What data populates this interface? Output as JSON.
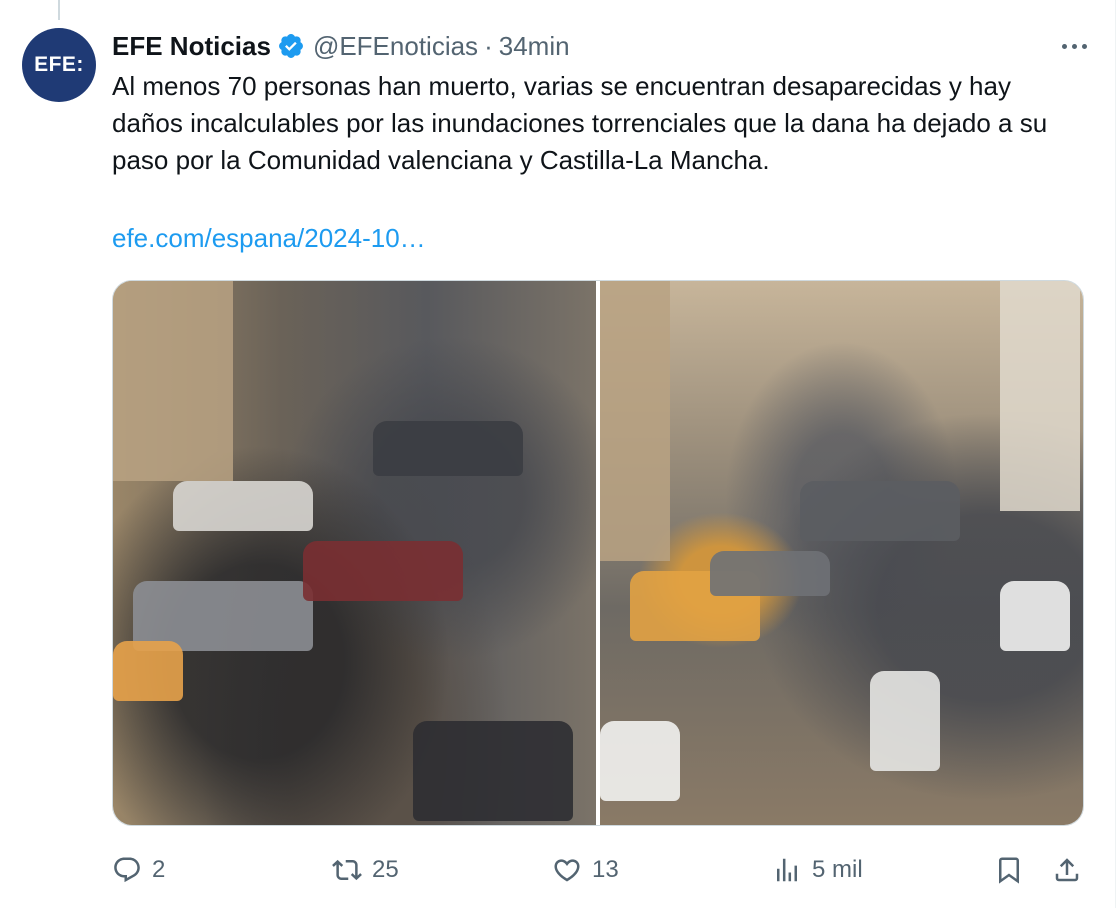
{
  "tweet": {
    "avatar_text": "EFE:",
    "display_name": "EFE Noticias",
    "handle": "@EFEnoticias",
    "separator": "·",
    "time": "34min",
    "text": "Al menos 70 personas han muerto, varias se encuentran desaparecidas y hay daños incalculables por las inundaciones torrenciales que la dana ha dejado a su paso por la Comunidad valenciana y Castilla-La Mancha.",
    "link": "efe.com/espana/2024-10…",
    "images": [
      {
        "description_icon": "flood-cars-street-photo"
      },
      {
        "description_icon": "flood-cars-street-photo"
      }
    ]
  },
  "actions": {
    "replies": "2",
    "retweets": "25",
    "likes": "13",
    "views": "5 mil"
  },
  "colors": {
    "text": "#0f1419",
    "secondary": "#536471",
    "link": "#1d9bf0",
    "verified": "#1d9bf0",
    "avatar_bg": "#1f3a75",
    "border": "#cfd9de"
  },
  "icons": {
    "more": "more-horizontal-icon",
    "verified": "verified-badge-icon",
    "reply": "reply-icon",
    "retweet": "retweet-icon",
    "like": "heart-icon",
    "views": "views-chart-icon",
    "bookmark": "bookmark-icon",
    "share": "share-icon"
  }
}
